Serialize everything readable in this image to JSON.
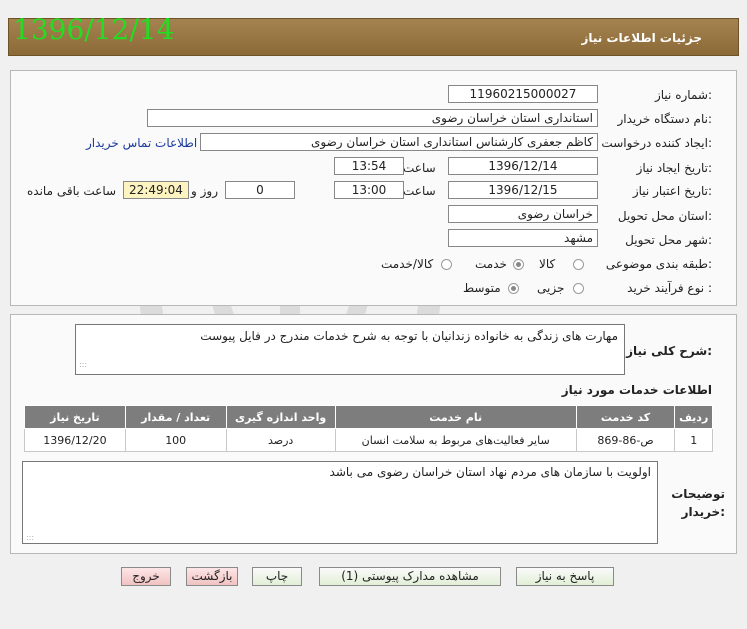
{
  "header": {
    "date": "1396/12/14",
    "title": "جزئیات اطلاعات نیاز"
  },
  "form": {
    "need_number_label": "شماره نیاز:",
    "need_number": "11960215000027",
    "buyer_org_label": "نام دستگاه خریدار:",
    "buyer_org": "استانداری استان خراسان رضوی",
    "requester_label": "ایجاد کننده درخواست:",
    "requester": "کاظم جعفری کارشناس استانداری استان خراسان رضوی",
    "contact_link": "اطلاعات تماس خریدار",
    "created_label": "تاریخ ایجاد نیاز:",
    "created_date": "1396/12/14",
    "time_label": "ساعت",
    "created_time": "13:54",
    "valid_label": "تاریخ اعتبار نیاز:",
    "valid_date": "1396/12/15",
    "valid_time": "13:00",
    "days_value": "0",
    "days_label": "روز و",
    "remaining_time": "22:49:04",
    "remaining_label": "ساعت باقی مانده",
    "province_label": "استان محل تحویل:",
    "province": "خراسان رضوی",
    "city_label": "شهر محل تحویل:",
    "city": "مشهد",
    "category_label": "طبقه بندی موضوعی:",
    "category_options": [
      "کالا",
      "خدمت",
      "کالا/خدمت"
    ],
    "category_selected": "خدمت",
    "process_label": "نوع فرآیند خرید :",
    "process_options": [
      "جزیی",
      "متوسط"
    ],
    "process_selected": "متوسط"
  },
  "description": {
    "label": "شرح کلی نیاز:",
    "text": "مهارت های زندگی به خانواده زندانیان با توجه به شرح خدمات مندرج در فایل پیوست"
  },
  "services": {
    "title": "اطلاعات خدمات مورد نیاز",
    "columns": [
      "ردیف",
      "کد خدمت",
      "نام خدمت",
      "واحد اندازه گیری",
      "تعداد / مقدار",
      "تاریخ نیاز"
    ],
    "rows": [
      [
        "1",
        "ص-86-869",
        "سایر فعالیت‌های مربوط به سلامت انسان",
        "درصد",
        "100",
        "1396/12/20"
      ]
    ]
  },
  "buyer_notes": {
    "label_line1": "توضیحات",
    "label_line2": "خریدار:",
    "text": "اولویت با سازمان های مردم نهاد استان خراسان رضوی می باشد"
  },
  "buttons": {
    "reply": "پاسخ به نیاز",
    "attachments": "مشاهده مدارک پیوستی (1)",
    "print": "چاپ",
    "back": "بازگشت",
    "exit": "خروج"
  },
  "colors": {
    "header_bg": "#9a7844",
    "header_date": "#22dd22",
    "table_header": "#7d7d7d"
  }
}
